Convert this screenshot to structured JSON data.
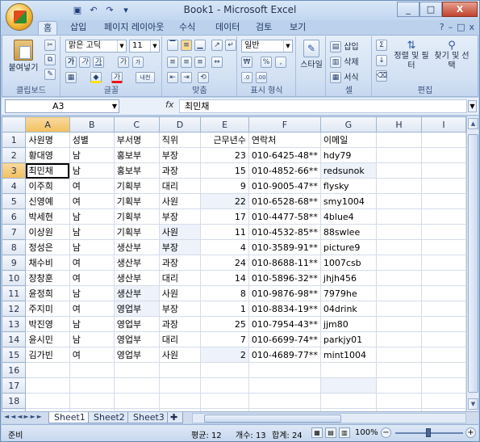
{
  "window": {
    "title": "Book1 - Microsoft Excel",
    "minimize": "_",
    "restore": "□",
    "close": "X"
  },
  "qat": {
    "save_icon": "save-icon",
    "undo_icon": "undo-icon",
    "redo_icon": "redo-icon"
  },
  "tabs": [
    "홈",
    "삽입",
    "페이지 레이아웃",
    "수식",
    "데이터",
    "검토",
    "보기"
  ],
  "ribbon": {
    "clipboard": {
      "paste": "붙여넣기",
      "label": "클립보드"
    },
    "font": {
      "name": "맑은 고딕",
      "size": "11",
      "bold": "가",
      "italic": "가",
      "underline": "가",
      "grow": "가",
      "shrink": "가",
      "color_a": "가",
      "phonetic": "내천",
      "label": "글꼴"
    },
    "alignment": {
      "label": "맞춤"
    },
    "number": {
      "format": "일반",
      "percent": "%",
      "comma": ",",
      "label": "표시 형식"
    },
    "styles": {
      "style": "스타일"
    },
    "cells": {
      "insert": "삽입",
      "delete": "삭제",
      "format": "서식",
      "label": "셀"
    },
    "editing": {
      "sum": "Σ",
      "sort": "정렬 및 필터",
      "find": "찾기 및 선택",
      "label": "편집"
    }
  },
  "formula_bar": {
    "name_box": "A3",
    "fx": "fx",
    "content": "최민채"
  },
  "grid": {
    "columns": [
      "A",
      "B",
      "C",
      "D",
      "E",
      "F",
      "G",
      "H",
      "I"
    ],
    "rows": [
      [
        "사원명",
        "성별",
        "부서명",
        "직위",
        "근무년수",
        "연락처",
        "이메일",
        "",
        ""
      ],
      [
        "황대영",
        "남",
        "홍보부",
        "부장",
        "23",
        "010-6425-48**",
        "hdy79",
        "",
        ""
      ],
      [
        "최민채",
        "남",
        "홍보부",
        "과장",
        "15",
        "010-4852-66**",
        "redsunok",
        "",
        ""
      ],
      [
        "이주희",
        "여",
        "기획부",
        "대리",
        "9",
        "010-9005-47**",
        "flysky",
        "",
        ""
      ],
      [
        "신영예",
        "여",
        "기획부",
        "사원",
        "22",
        "010-6528-68**",
        "smy1004",
        "",
        ""
      ],
      [
        "박세현",
        "남",
        "기획부",
        "부장",
        "17",
        "010-4477-58**",
        "4blue4",
        "",
        ""
      ],
      [
        "이상원",
        "남",
        "기획부",
        "사원",
        "11",
        "010-4532-85**",
        "88swlee",
        "",
        ""
      ],
      [
        "정성은",
        "남",
        "생산부",
        "부장",
        "4",
        "010-3589-91**",
        "picture9",
        "",
        ""
      ],
      [
        "채수비",
        "여",
        "생산부",
        "과장",
        "24",
        "010-8688-11**",
        "1007csb",
        "",
        ""
      ],
      [
        "장창훈",
        "여",
        "생산부",
        "대리",
        "14",
        "010-5896-32**",
        "jhjh456",
        "",
        ""
      ],
      [
        "윤정희",
        "남",
        "생산부",
        "사원",
        "8",
        "010-9876-98**",
        "7979he",
        "",
        ""
      ],
      [
        "주지미",
        "여",
        "영업부",
        "부장",
        "1",
        "010-8834-19**",
        "04drink",
        "",
        ""
      ],
      [
        "박진영",
        "남",
        "영업부",
        "과장",
        "25",
        "010-7954-43**",
        "jjm80",
        "",
        ""
      ],
      [
        "윤시민",
        "남",
        "영업부",
        "대리",
        "7",
        "010-6699-74**",
        "parkjy01",
        "",
        ""
      ],
      [
        "김가빈",
        "여",
        "영업부",
        "사원",
        "2",
        "010-4689-77**",
        "mint1004",
        "",
        ""
      ],
      [
        "",
        "",
        "",
        "",
        "",
        "",
        "",
        "",
        ""
      ],
      [
        "",
        "",
        "",
        "",
        "",
        "",
        "",
        "",
        ""
      ],
      [
        "",
        "",
        "",
        "",
        "",
        "",
        "",
        "",
        ""
      ],
      [
        "",
        "",
        "",
        "",
        "",
        "",
        "",
        "",
        ""
      ],
      [
        "",
        "",
        "",
        "",
        "",
        "",
        "",
        "",
        ""
      ]
    ]
  },
  "sheets": [
    "Sheet1",
    "Sheet2",
    "Sheet3"
  ],
  "status": {
    "ready": "준비",
    "average": "평균: 12",
    "count": "개수: 13",
    "sum": "합계: 24",
    "zoom": "100%",
    "zoom_out": "−",
    "zoom_in": "+"
  }
}
